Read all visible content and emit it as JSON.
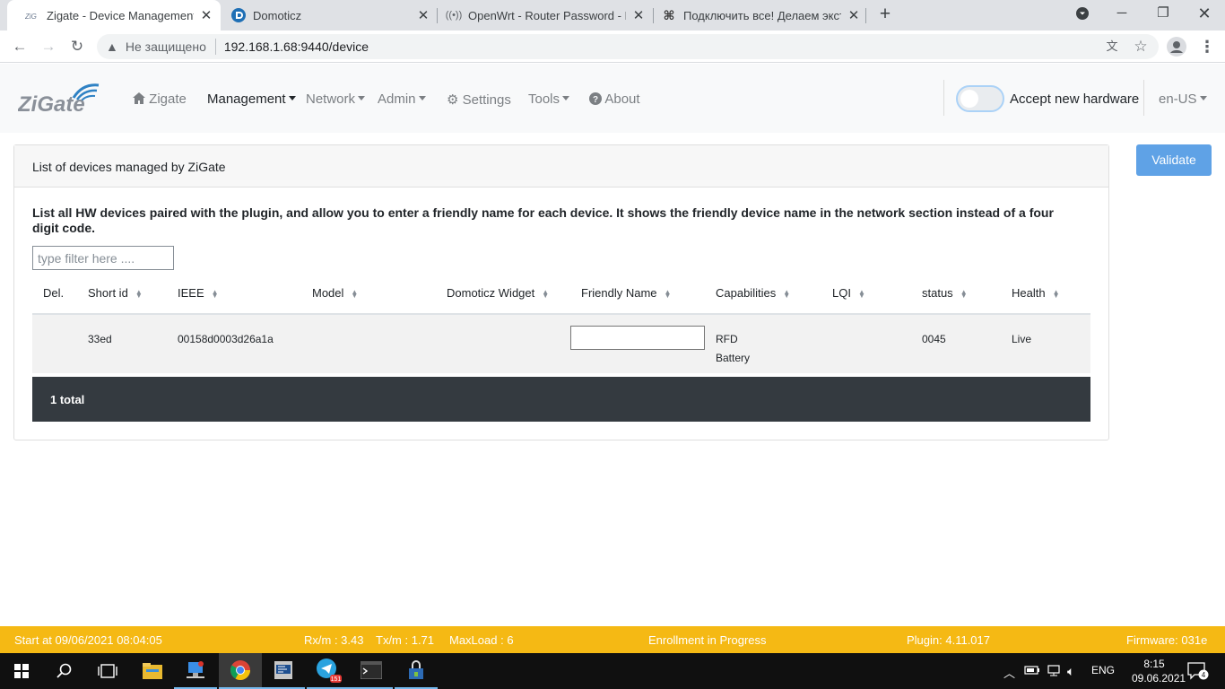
{
  "browser": {
    "tabs": [
      {
        "title": "Zigate - Device Management",
        "active": true,
        "icon": "zigate-favicon"
      },
      {
        "title": "Domoticz",
        "active": false,
        "icon": "domoticz-favicon"
      },
      {
        "title": "OpenWrt - Router Password - Lu",
        "active": false,
        "icon": "openwrt-favicon"
      },
      {
        "title": "Подключить все! Делаем экстре",
        "active": false,
        "icon": "habr-favicon"
      }
    ],
    "insecure_label": "Не защищено",
    "url": "192.168.1.68:9440/device"
  },
  "navbar": {
    "logo_text": "ZiGate",
    "items": [
      {
        "label": "Zigate",
        "icon": "home-icon"
      },
      {
        "label": "Management",
        "dropdown": true,
        "active": true
      },
      {
        "label": "Network",
        "dropdown": true
      },
      {
        "label": "Admin",
        "dropdown": true
      },
      {
        "label": "Settings",
        "icon": "gear-icon"
      },
      {
        "label": "Tools",
        "dropdown": true
      },
      {
        "label": "About",
        "icon": "question-circle-icon"
      }
    ],
    "toggle_label": "Accept new hardware",
    "toggle_on": false,
    "language": "en-US"
  },
  "card": {
    "header": "List of devices managed by ZiGate",
    "description": "List all HW devices paired with the plugin, and allow you to enter a friendly name for each device. It shows the friendly device name in the network section instead of a four digit code.",
    "filter_placeholder": "type filter here ....",
    "columns": [
      "Del.",
      "Short id",
      "IEEE",
      "Model",
      "Domoticz Widget",
      "Friendly Name",
      "Capabilities",
      "LQI",
      "status",
      "Health"
    ],
    "rows": [
      {
        "del": "",
        "short_id": "33ed",
        "ieee": "00158d0003d26a1a",
        "model": "",
        "widget": "",
        "friendly_name": "",
        "capabilities": [
          "RFD",
          "Battery"
        ],
        "lqi": "",
        "status": "0045",
        "health": "Live"
      }
    ],
    "footer": "1 total"
  },
  "validate_label": "Validate",
  "statusbar": {
    "start": "Start at 09/06/2021 08:04:05",
    "rx": "Rx/m : 3.43",
    "tx": "Tx/m : 1.71",
    "maxload": "MaxLoad : 6",
    "enrollment": "Enrollment in Progress",
    "plugin": "Plugin: 4.11.017",
    "firmware": "Firmware: 031e"
  },
  "taskbar": {
    "telegram_badge": "151",
    "lang": "ENG",
    "time": "8:15",
    "date": "09.06.2021",
    "notifications": "4"
  },
  "colors": {
    "statusbar": "#f5b914",
    "validate": "#5fa2e6",
    "table_footer": "#343a40",
    "navbar_bg": "#f8f9fa"
  }
}
